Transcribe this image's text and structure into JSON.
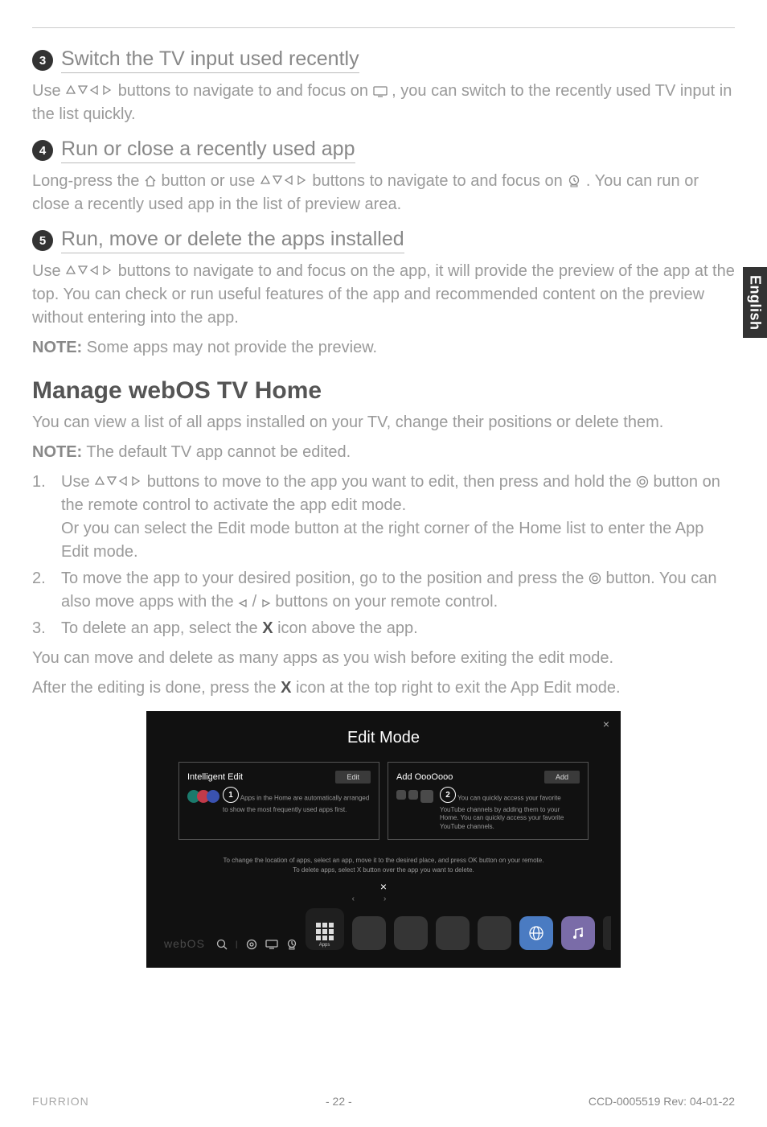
{
  "language_tab": "English",
  "sections": {
    "s3": {
      "num": "3",
      "title": "Switch the TV input used recently",
      "body_before": "Use ",
      "body_after_nav": " buttons to navigate to and focus on ",
      "body_end": ", you can switch to the recently used TV input in the list quickly."
    },
    "s4": {
      "num": "4",
      "title": "Run or close a recently used app",
      "body_before": "Long-press the ",
      "body_mid": " button or use ",
      "body_after_nav": " buttons to navigate to and focus on ",
      "body_end": ". You can run or close a recently used app in the list of preview area."
    },
    "s5": {
      "num": "5",
      "title": "Run, move or delete the apps installed",
      "body_before": "Use ",
      "body_after_nav": " buttons to navigate to and focus on the app, it will provide the preview of the app at the top. You can check or run useful features of the app and recommended content on the preview without entering into the app.",
      "note_label": "NOTE:",
      "note_text": " Some apps may not provide the preview."
    }
  },
  "manage": {
    "title": "Manage webOS TV Home",
    "intro": "You can view a list of all apps installed on your TV, change their positions or delete them.",
    "note_label": "NOTE:",
    "note_text": " The default TV app cannot be edited.",
    "step1_a": "Use ",
    "step1_b": " buttons to move to the app you want to edit, then press and hold the ",
    "step1_c": " button on the remote control to activate the app edit mode.",
    "step1_d": "Or you can select the Edit mode button at the right corner of the Home list to enter the App Edit mode.",
    "step2_a": "To move the app to your desired position, go to the position and press the ",
    "step2_b": " button. You can also move apps with the ",
    "step2_c": " buttons on your remote control.",
    "step3_a": "To delete an app, select the ",
    "step3_x": "X",
    "step3_b": " icon above the app.",
    "outro1": "You can move and delete as many apps as you wish before exiting the edit mode.",
    "outro2_a": "After the editing is done, press the ",
    "outro2_x": "X",
    "outro2_b": " icon at the top right to exit the App Edit mode."
  },
  "screenshot": {
    "title": "Edit Mode",
    "close": "×",
    "card1": {
      "title": "Intelligent Edit",
      "btn": "Edit",
      "num": "1",
      "desc": "Apps in the Home are automatically arranged to show the most frequently used apps first."
    },
    "card2": {
      "title": "Add OooOooo",
      "btn": "Add",
      "num": "2",
      "desc": "You can quickly access your favorite YouTube channels by adding them to your Home. You can quickly access your favorite YouTube channels."
    },
    "instr1": "To change the location of apps, select an app, move it to the desired place, and press OK button on your remote.",
    "instr2": "To delete apps, select X button over the app you want to delete.",
    "webos": "webOS",
    "apps_label": "Apps"
  },
  "footer": {
    "brand": "FURRION",
    "page": "- 22 -",
    "rev": "CCD-0005519 Rev: 04-01-22"
  }
}
